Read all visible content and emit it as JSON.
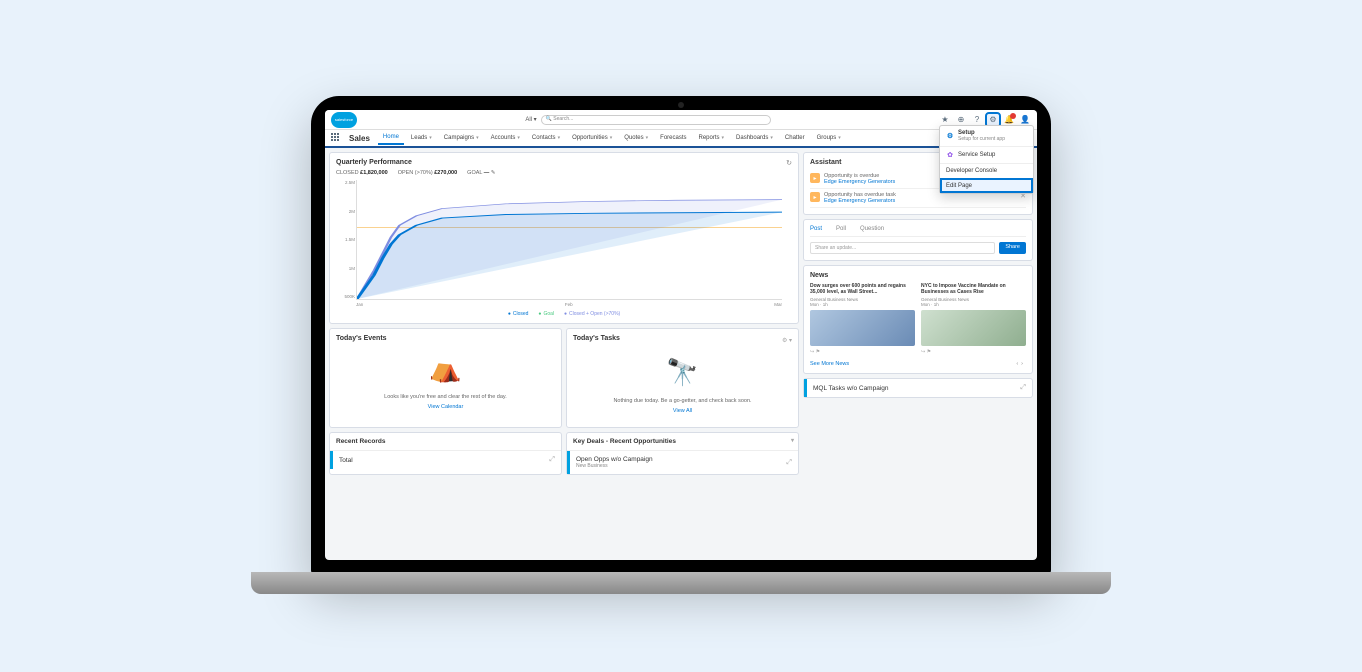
{
  "header": {
    "logo_text": "salesforce",
    "search_scope": "All ▾",
    "search_placeholder": "Search...",
    "icons": [
      "star",
      "history",
      "add",
      "help",
      "gear",
      "bell",
      "avatar"
    ]
  },
  "nav": {
    "app_name": "Sales",
    "tabs": [
      "Home",
      "Leads",
      "Campaigns",
      "Accounts",
      "Contacts",
      "Opportunities",
      "Quotes",
      "Forecasts",
      "Reports",
      "Dashboards",
      "Chatter",
      "Groups"
    ]
  },
  "setup_menu": {
    "title": "Setup",
    "subtitle": "Setup for current app",
    "items": [
      "Service Setup",
      "Developer Console",
      "Edit Page"
    ]
  },
  "quarterly": {
    "title": "Quarterly Performance",
    "closed_label": "CLOSED",
    "closed_value": "£1,820,000",
    "open_label": "OPEN (>70%)",
    "open_value": "£270,000",
    "goal_label": "GOAL",
    "goal_value": "—",
    "legend": {
      "closed": "Closed",
      "goal": "Goal",
      "open": "Closed + Open (>70%)"
    }
  },
  "chart_data": {
    "type": "line",
    "title": "Quarterly Performance",
    "xlabel": "",
    "ylabel": "",
    "x_ticks": [
      "Jan",
      "Feb",
      "Mar"
    ],
    "y_ticks": [
      "2.5M",
      "2M",
      "1.5M",
      "1M",
      "500K"
    ],
    "ylim": [
      0,
      2500000
    ],
    "series": [
      {
        "name": "Closed",
        "color": "#0176d3",
        "x": [
          0,
          0.02,
          0.04,
          0.06,
          0.08,
          0.1,
          0.14,
          0.2,
          0.35,
          0.55,
          0.75,
          1.0
        ],
        "y": [
          0,
          250000,
          500000,
          850000,
          1150000,
          1350000,
          1550000,
          1700000,
          1780000,
          1800000,
          1810000,
          1820000
        ]
      },
      {
        "name": "Closed + Open (>70%)",
        "color": "#7f8de1",
        "x": [
          0,
          0.02,
          0.04,
          0.06,
          0.08,
          0.1,
          0.14,
          0.2,
          0.35,
          0.55,
          0.75,
          1.0
        ],
        "y": [
          0,
          300000,
          600000,
          950000,
          1300000,
          1550000,
          1750000,
          1900000,
          2000000,
          2050000,
          2080000,
          2090000
        ]
      },
      {
        "name": "Goal",
        "color": "#f5a623",
        "type": "hline",
        "y": 1500000
      }
    ]
  },
  "events": {
    "title": "Today's Events",
    "msg": "Looks like you're free and clear the rest of the day.",
    "link": "View Calendar"
  },
  "tasks": {
    "title": "Today's Tasks",
    "msg": "Nothing due today. Be a go-getter, and check back soon.",
    "link": "View All"
  },
  "recent": {
    "title": "Recent Records",
    "item": "Total"
  },
  "deals": {
    "title": "Key Deals - Recent Opportunities",
    "item": "Open Opps w/o Campaign",
    "item_sub": "New Business"
  },
  "mql": {
    "item": "MQL Tasks w/o Campaign"
  },
  "assistant": {
    "title": "Assistant",
    "items": [
      {
        "t1": "Opportunity is overdue",
        "t2": "Edge Emergency Generators"
      },
      {
        "t1": "Opportunity has overdue task",
        "t2": "Edge Emergency Generators"
      }
    ]
  },
  "feed": {
    "tabs": [
      "Post",
      "Poll",
      "Question"
    ],
    "placeholder": "Share an update...",
    "button": "Share"
  },
  "news": {
    "title": "News",
    "items": [
      {
        "t": "Dow surges over 600 points and regains 35,000 level, as Wall Street...",
        "s": "General Business News",
        "d": "Mon · 1h"
      },
      {
        "t": "NYC to Impose Vaccine Mandate on Businesses as Cases Rise",
        "s": "General Business News",
        "d": "Mon · 1h"
      }
    ],
    "more": "See More News"
  }
}
